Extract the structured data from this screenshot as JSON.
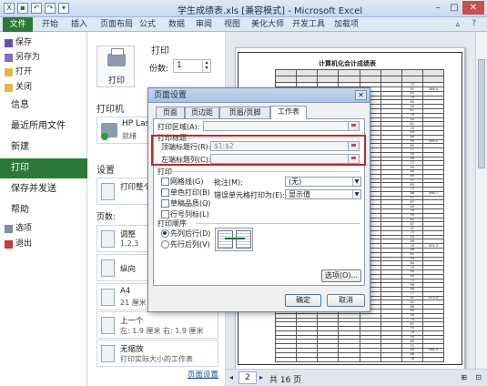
{
  "window": {
    "title": "学生成绩表.xls [兼容模式] - Microsoft Excel",
    "qat_icons": [
      "excel-logo-icon",
      "save-icon",
      "undo-icon",
      "redo-icon",
      "qat-dropdown-icon"
    ]
  },
  "ribbon": {
    "tabs": [
      "文件",
      "开始",
      "插入",
      "页面布局",
      "公式",
      "数据",
      "审阅",
      "视图",
      "美化大师",
      "开发工具",
      "加载项"
    ]
  },
  "backstage": {
    "nav_top": [
      {
        "label": "保存",
        "icon": "save-icon"
      },
      {
        "label": "另存为",
        "icon": "save-as-icon"
      },
      {
        "label": "打开",
        "icon": "open-folder-icon"
      },
      {
        "label": "关闭",
        "icon": "close-file-icon"
      }
    ],
    "nav_main": [
      "信息",
      "最近所用文件",
      "新建",
      "打印",
      "保存并发送",
      "帮助"
    ],
    "nav_active": "打印",
    "nav_bottom": [
      {
        "label": "选项",
        "icon": "options-icon"
      },
      {
        "label": "退出",
        "icon": "exit-icon"
      }
    ]
  },
  "print_panel": {
    "section_title": "打印",
    "print_button": "打印",
    "copies_label": "份数:",
    "copies_value": "1",
    "printer_title": "打印机",
    "printer_name": "HP Lase",
    "printer_status": "就绪",
    "settings_title": "设置",
    "setting_print_what": "打印整个",
    "pages_label": "页数:",
    "setting_collate": "调整",
    "setting_collate_sub": "1,2,3",
    "setting_orientation": "纵向",
    "setting_paper": "A4",
    "setting_paper_sub": "21 厘米",
    "setting_margins": "上一个",
    "setting_margins_sub": "左: 1.9 厘米    右: 1.9 厘米",
    "setting_scaling": "无缩放",
    "setting_scaling_sub": "打印实际大小的工作表",
    "page_setup_link": "页面设置"
  },
  "preview": {
    "sheet_title": "计算机化会计成绩表",
    "page_current": "2",
    "page_total": "共 16 页",
    "scores": [
      "96",
      "88",
      "72",
      "91",
      "83",
      "79",
      "65",
      "94",
      "87",
      "76",
      "92",
      "81",
      "74",
      "89",
      "68",
      "95",
      "82",
      "71",
      "90",
      "86",
      "77",
      "93",
      "84",
      "69",
      "97",
      "80",
      "73",
      "88",
      "91",
      "67",
      "85",
      "78",
      "94",
      "62",
      "87",
      "92",
      "75",
      "83",
      "99",
      "70",
      "86",
      "81",
      "93",
      "64",
      "79",
      "90",
      "84",
      "72",
      "96",
      "88",
      "77",
      "82",
      "91",
      "68",
      "85",
      "90",
      "74",
      "87",
      "93",
      "79",
      "95",
      "80",
      "71",
      "89",
      "86",
      "76"
    ],
    "total_samples": [
      "586.4",
      "556.1",
      "598.7",
      "554.3",
      "553.4"
    ]
  },
  "dialog": {
    "title": "页面设置",
    "tabs": [
      "页面",
      "页边距",
      "页眉/页脚",
      "工作表"
    ],
    "active_tab": "工作表",
    "print_area_label": "打印区域(A):",
    "print_titles_group": "打印标题",
    "rows_to_repeat_label": "顶端标题行(R):",
    "rows_to_repeat_value": "$1:$2",
    "cols_to_repeat_label": "左端标题列(C):",
    "cols_to_repeat_value": "",
    "print_group": "打印",
    "gridlines": "网格线(G)",
    "bw": "单色打印(B)",
    "draft": "草稿品质(Q)",
    "row_col_headings": "行号列标(L)",
    "comments_label": "批注(M):",
    "comments_value": "(无)",
    "errors_label": "错误单元格打印为(E):",
    "errors_value": "显示值",
    "page_order_group": "打印顺序",
    "down_then_over": "先列后行(D)",
    "over_then_down": "先行后列(V)",
    "options_button": "选项(O)...",
    "ok_button": "确定",
    "cancel_button": "取消"
  }
}
